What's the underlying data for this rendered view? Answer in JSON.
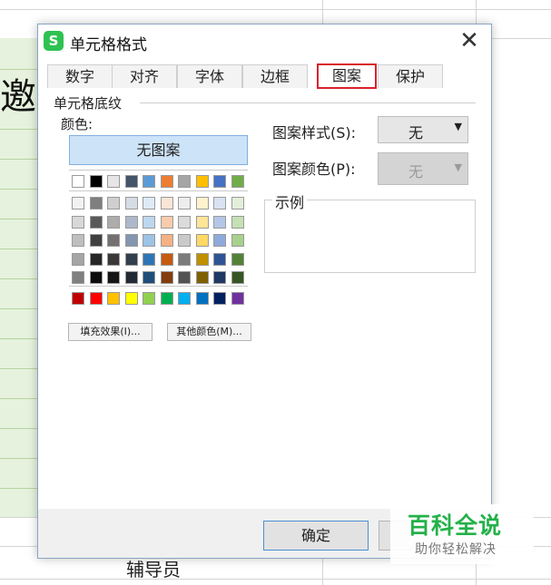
{
  "sheet": {
    "cell_char": "邀",
    "bottom_label": "辅导员"
  },
  "dialog": {
    "icon_letter": "S",
    "title": "单元格格式",
    "close_glyph": "✕",
    "tabs": [
      {
        "label": "数字",
        "active": false
      },
      {
        "label": "对齐",
        "active": false
      },
      {
        "label": "字体",
        "active": false
      },
      {
        "label": "边框",
        "active": false
      },
      {
        "label": "图案",
        "active": true
      },
      {
        "label": "保护",
        "active": false
      }
    ],
    "shading_group_label": "单元格底纹",
    "color_label": "颜色:",
    "no_pattern_label": "无图案",
    "fill_effects_label": "填充效果(I)...",
    "more_colors_label": "其他颜色(M)...",
    "pattern_style_label": "图案样式(S):",
    "pattern_style_value": "无",
    "pattern_color_label": "图案颜色(P):",
    "pattern_color_value": "无",
    "example_label": "示例",
    "ok_label": "确定",
    "active_tab_color": "#d9222a",
    "palette": {
      "theme_top": [
        "#ffffff",
        "#000000",
        "#e7e6e6",
        "#44546a",
        "#5b9bd5",
        "#ed7d31",
        "#a5a5a5",
        "#ffc000",
        "#4472c4",
        "#70ad47"
      ],
      "theme_shades": [
        [
          "#f2f2f2",
          "#7f7f7f",
          "#d0cece",
          "#d6dce4",
          "#deebf6",
          "#fbe5d5",
          "#ededed",
          "#fff2cc",
          "#d9e2f3",
          "#e2efd9"
        ],
        [
          "#d8d8d8",
          "#595959",
          "#aeabab",
          "#adb9ca",
          "#bdd7ee",
          "#f7cbac",
          "#dbdbdb",
          "#fee599",
          "#b4c6e7",
          "#c5e0b3"
        ],
        [
          "#bfbfbf",
          "#3f3f3f",
          "#757070",
          "#8496b0",
          "#9dc3e6",
          "#f4b183",
          "#c9c9c9",
          "#ffd965",
          "#8eaadb",
          "#a8d08d"
        ],
        [
          "#a5a5a5",
          "#262626",
          "#3a3838",
          "#323f4f",
          "#2e75b5",
          "#c55a11",
          "#7b7b7b",
          "#bf9000",
          "#2f5496",
          "#538135"
        ],
        [
          "#7f7f7f",
          "#0c0c0c",
          "#171616",
          "#222a35",
          "#1e4e79",
          "#833c0b",
          "#525252",
          "#7f6000",
          "#1f3864",
          "#375623"
        ]
      ],
      "standard": [
        "#c00000",
        "#ff0000",
        "#ffc000",
        "#ffff00",
        "#92d050",
        "#00b050",
        "#00b0f0",
        "#0070c0",
        "#002060",
        "#7030a0"
      ]
    }
  },
  "watermark": {
    "main": "百科全说",
    "sub": "助你轻松解决",
    "color": "#24b14a"
  }
}
